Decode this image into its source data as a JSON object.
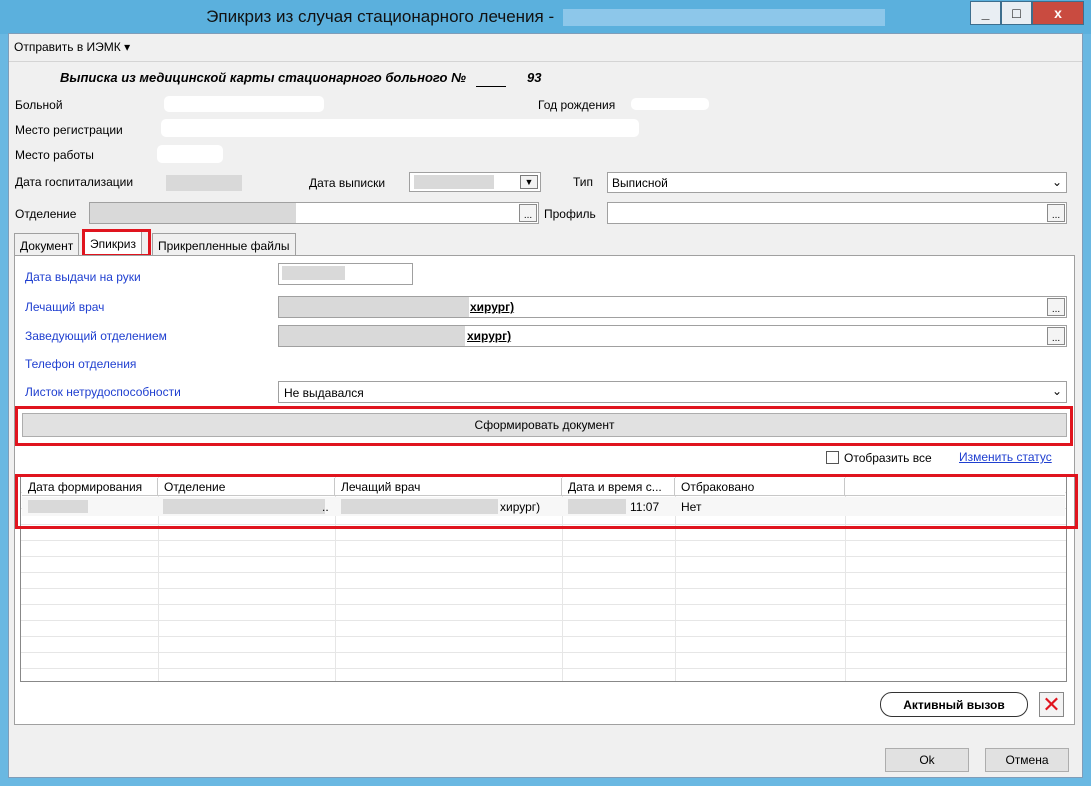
{
  "window": {
    "title": "Эпикриз из случая стационарного лечения - ",
    "controls": {
      "minimize": "_",
      "maximize": "□",
      "close": "x"
    }
  },
  "menu": {
    "send_label": "Отправить в ИЭМК",
    "send_arrow": "▾"
  },
  "form": {
    "heading": "Выписка из медицинской карты стационарного больного №",
    "card_number": "93",
    "patient_label": "Больной",
    "birth_year_label": "Год рождения",
    "registration_label": "Место регистрации",
    "work_label": "Место работы",
    "admission_date_label": "Дата госпитализации",
    "discharge_date_label": "Дата выписки",
    "type_label": "Тип",
    "type_value": "Выписной",
    "department_label": "Отделение",
    "profile_label": "Профиль"
  },
  "tabs": [
    "Документ",
    "Эпикриз",
    "Прикрепленные файлы"
  ],
  "epicrisis": {
    "issue_date_label": "Дата выдачи на руки",
    "doctor_label": "Лечащий врач",
    "doctor_suffix": "хирург)",
    "head_label": "Заведующий отделением",
    "head_suffix": "хирург)",
    "phone_label": "Телефон отделения",
    "sick_leave_label": "Листок нетрудоспособности",
    "sick_leave_value": "Не выдавался",
    "generate_button": "Сформировать документ"
  },
  "list_options": {
    "show_all_label": "Отобразить все",
    "change_status_link": "Изменить статус"
  },
  "grid": {
    "columns": [
      "Дата формирования",
      "Отделение",
      "Лечащий врач",
      "Дата и время с...",
      "Отбраковано"
    ],
    "rows": [
      {
        "dept_tail": "..",
        "doctor_tail": "хирург)",
        "time": "11:07",
        "rejected": "Нет"
      }
    ]
  },
  "footer": {
    "active_call_button": "Активный вызов",
    "ok_button": "Ok",
    "cancel_button": "Отмена"
  },
  "colors": {
    "highlight_red": "#e0141e",
    "label_blue": "#1f3fd0",
    "title_bar": "#5bb0dd"
  }
}
